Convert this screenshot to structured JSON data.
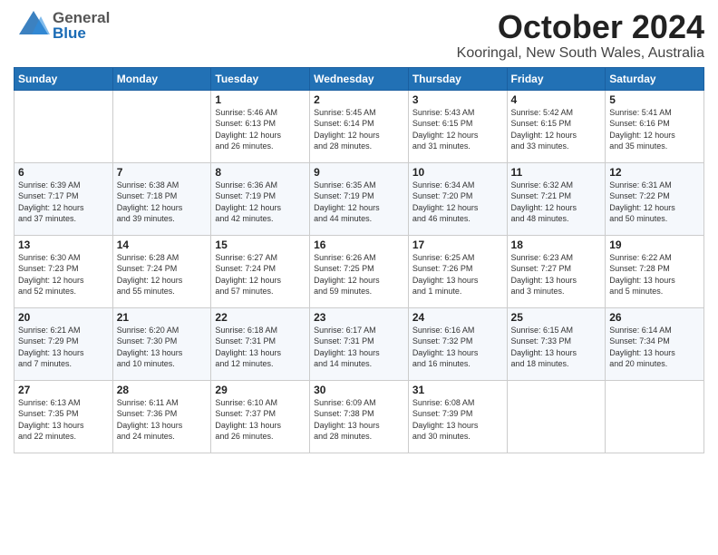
{
  "header": {
    "logo_general": "General",
    "logo_blue": "Blue",
    "month_title": "October 2024",
    "location": "Kooringal, New South Wales, Australia"
  },
  "days_of_week": [
    "Sunday",
    "Monday",
    "Tuesday",
    "Wednesday",
    "Thursday",
    "Friday",
    "Saturday"
  ],
  "weeks": [
    [
      {
        "day": "",
        "info": ""
      },
      {
        "day": "",
        "info": ""
      },
      {
        "day": "1",
        "info": "Sunrise: 5:46 AM\nSunset: 6:13 PM\nDaylight: 12 hours\nand 26 minutes."
      },
      {
        "day": "2",
        "info": "Sunrise: 5:45 AM\nSunset: 6:14 PM\nDaylight: 12 hours\nand 28 minutes."
      },
      {
        "day": "3",
        "info": "Sunrise: 5:43 AM\nSunset: 6:15 PM\nDaylight: 12 hours\nand 31 minutes."
      },
      {
        "day": "4",
        "info": "Sunrise: 5:42 AM\nSunset: 6:15 PM\nDaylight: 12 hours\nand 33 minutes."
      },
      {
        "day": "5",
        "info": "Sunrise: 5:41 AM\nSunset: 6:16 PM\nDaylight: 12 hours\nand 35 minutes."
      }
    ],
    [
      {
        "day": "6",
        "info": "Sunrise: 6:39 AM\nSunset: 7:17 PM\nDaylight: 12 hours\nand 37 minutes."
      },
      {
        "day": "7",
        "info": "Sunrise: 6:38 AM\nSunset: 7:18 PM\nDaylight: 12 hours\nand 39 minutes."
      },
      {
        "day": "8",
        "info": "Sunrise: 6:36 AM\nSunset: 7:19 PM\nDaylight: 12 hours\nand 42 minutes."
      },
      {
        "day": "9",
        "info": "Sunrise: 6:35 AM\nSunset: 7:19 PM\nDaylight: 12 hours\nand 44 minutes."
      },
      {
        "day": "10",
        "info": "Sunrise: 6:34 AM\nSunset: 7:20 PM\nDaylight: 12 hours\nand 46 minutes."
      },
      {
        "day": "11",
        "info": "Sunrise: 6:32 AM\nSunset: 7:21 PM\nDaylight: 12 hours\nand 48 minutes."
      },
      {
        "day": "12",
        "info": "Sunrise: 6:31 AM\nSunset: 7:22 PM\nDaylight: 12 hours\nand 50 minutes."
      }
    ],
    [
      {
        "day": "13",
        "info": "Sunrise: 6:30 AM\nSunset: 7:23 PM\nDaylight: 12 hours\nand 52 minutes."
      },
      {
        "day": "14",
        "info": "Sunrise: 6:28 AM\nSunset: 7:24 PM\nDaylight: 12 hours\nand 55 minutes."
      },
      {
        "day": "15",
        "info": "Sunrise: 6:27 AM\nSunset: 7:24 PM\nDaylight: 12 hours\nand 57 minutes."
      },
      {
        "day": "16",
        "info": "Sunrise: 6:26 AM\nSunset: 7:25 PM\nDaylight: 12 hours\nand 59 minutes."
      },
      {
        "day": "17",
        "info": "Sunrise: 6:25 AM\nSunset: 7:26 PM\nDaylight: 13 hours\nand 1 minute."
      },
      {
        "day": "18",
        "info": "Sunrise: 6:23 AM\nSunset: 7:27 PM\nDaylight: 13 hours\nand 3 minutes."
      },
      {
        "day": "19",
        "info": "Sunrise: 6:22 AM\nSunset: 7:28 PM\nDaylight: 13 hours\nand 5 minutes."
      }
    ],
    [
      {
        "day": "20",
        "info": "Sunrise: 6:21 AM\nSunset: 7:29 PM\nDaylight: 13 hours\nand 7 minutes."
      },
      {
        "day": "21",
        "info": "Sunrise: 6:20 AM\nSunset: 7:30 PM\nDaylight: 13 hours\nand 10 minutes."
      },
      {
        "day": "22",
        "info": "Sunrise: 6:18 AM\nSunset: 7:31 PM\nDaylight: 13 hours\nand 12 minutes."
      },
      {
        "day": "23",
        "info": "Sunrise: 6:17 AM\nSunset: 7:31 PM\nDaylight: 13 hours\nand 14 minutes."
      },
      {
        "day": "24",
        "info": "Sunrise: 6:16 AM\nSunset: 7:32 PM\nDaylight: 13 hours\nand 16 minutes."
      },
      {
        "day": "25",
        "info": "Sunrise: 6:15 AM\nSunset: 7:33 PM\nDaylight: 13 hours\nand 18 minutes."
      },
      {
        "day": "26",
        "info": "Sunrise: 6:14 AM\nSunset: 7:34 PM\nDaylight: 13 hours\nand 20 minutes."
      }
    ],
    [
      {
        "day": "27",
        "info": "Sunrise: 6:13 AM\nSunset: 7:35 PM\nDaylight: 13 hours\nand 22 minutes."
      },
      {
        "day": "28",
        "info": "Sunrise: 6:11 AM\nSunset: 7:36 PM\nDaylight: 13 hours\nand 24 minutes."
      },
      {
        "day": "29",
        "info": "Sunrise: 6:10 AM\nSunset: 7:37 PM\nDaylight: 13 hours\nand 26 minutes."
      },
      {
        "day": "30",
        "info": "Sunrise: 6:09 AM\nSunset: 7:38 PM\nDaylight: 13 hours\nand 28 minutes."
      },
      {
        "day": "31",
        "info": "Sunrise: 6:08 AM\nSunset: 7:39 PM\nDaylight: 13 hours\nand 30 minutes."
      },
      {
        "day": "",
        "info": ""
      },
      {
        "day": "",
        "info": ""
      }
    ]
  ]
}
